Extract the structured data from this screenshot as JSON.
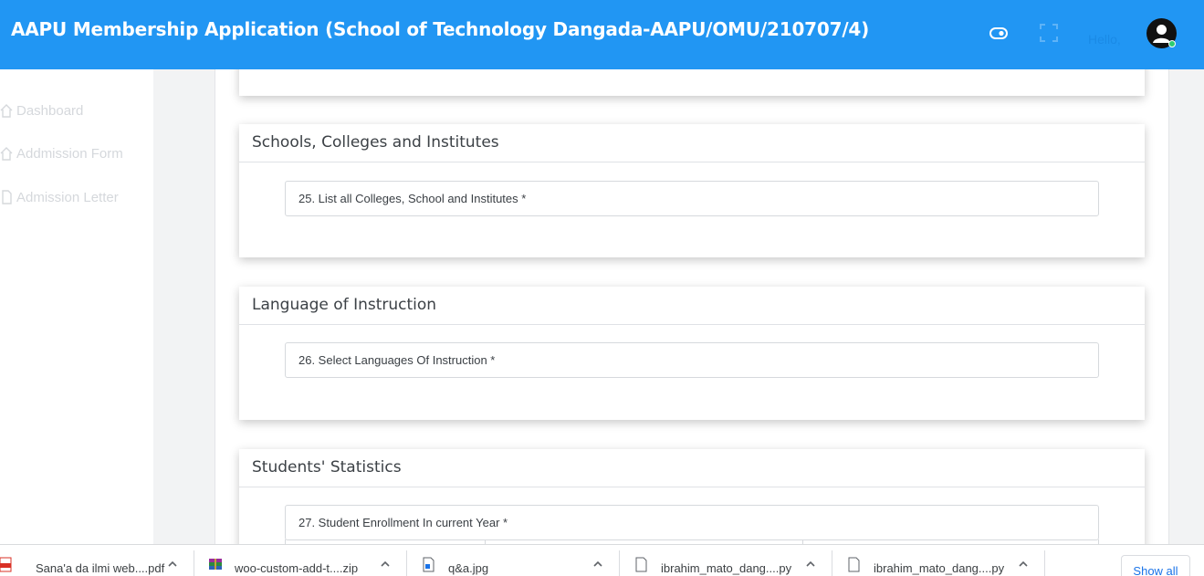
{
  "header": {
    "title": "AAPU Membership Application (School of Technology Dangada-AAPU/OMU/210707/4)",
    "greeting": "Hello,"
  },
  "sidebar": {
    "items": [
      {
        "label": "Dashboard",
        "icon": "home-icon"
      },
      {
        "label": "Addmission Form",
        "icon": "home-icon"
      },
      {
        "label": "Admission Letter",
        "icon": "document-icon"
      }
    ]
  },
  "sections": [
    {
      "title": "Schools, Colleges and Institutes",
      "field_label": "25. List all Colleges, School and Institutes *"
    },
    {
      "title": "Language of Instruction",
      "field_label": "26. Select Languages Of Instruction *"
    },
    {
      "title": "Students' Statistics",
      "field_label": "27. Student Enrollment In current Year *"
    }
  ],
  "downloads": {
    "items": [
      {
        "name": "Sana'a da ilmi web....pdf",
        "icon": "pdf-file-icon"
      },
      {
        "name": "woo-custom-add-t....zip",
        "icon": "zip-archive-icon"
      },
      {
        "name": "q&a.jpg",
        "icon": "image-file-icon"
      },
      {
        "name": "ibrahim_mato_dang....py",
        "icon": "file-icon"
      },
      {
        "name": "ibrahim_mato_dang....py",
        "icon": "file-icon"
      }
    ],
    "show_all_label": "Show all"
  },
  "colors": {
    "header_bg": "#2196f3",
    "sidebar_text": "#d5d8dc",
    "show_all": "#1a73e8",
    "online_status": "#2ecc71"
  }
}
